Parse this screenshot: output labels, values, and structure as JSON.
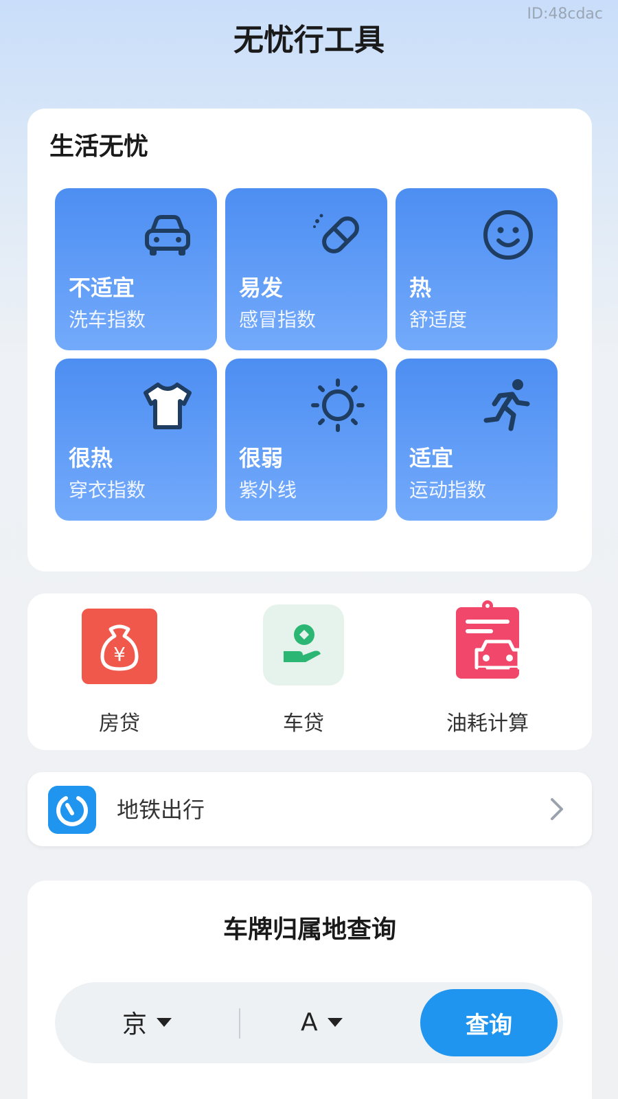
{
  "watermark": "ID:48cdac",
  "page_title": "无忧行工具",
  "life_section": {
    "title": "生活无忧",
    "tiles": [
      {
        "value": "不适宜",
        "label": "洗车指数",
        "icon": "car-icon"
      },
      {
        "value": "易发",
        "label": "感冒指数",
        "icon": "pill-icon"
      },
      {
        "value": "热",
        "label": "舒适度",
        "icon": "smiley-icon"
      },
      {
        "value": "很热",
        "label": "穿衣指数",
        "icon": "tshirt-icon"
      },
      {
        "value": "很弱",
        "label": "紫外线",
        "icon": "sun-icon"
      },
      {
        "value": "适宜",
        "label": "运动指数",
        "icon": "runner-icon"
      }
    ],
    "tile_color_top": "#4d8ef2",
    "tile_color_bottom": "#73aafb"
  },
  "loan_section": {
    "items": [
      {
        "label": "房贷",
        "icon": "money-bag-icon",
        "color": "#f0584c"
      },
      {
        "label": "车贷",
        "icon": "hand-coin-icon",
        "color": "#2bb673"
      },
      {
        "label": "油耗计算",
        "icon": "clipboard-car-icon",
        "color": "#f0476a"
      }
    ]
  },
  "metro": {
    "label": "地铁出行",
    "icon": "metro-icon"
  },
  "plate_query": {
    "title": "车牌归属地查询",
    "province": "京",
    "letter": "A",
    "button": "查询",
    "accent": "#1f95f0"
  }
}
